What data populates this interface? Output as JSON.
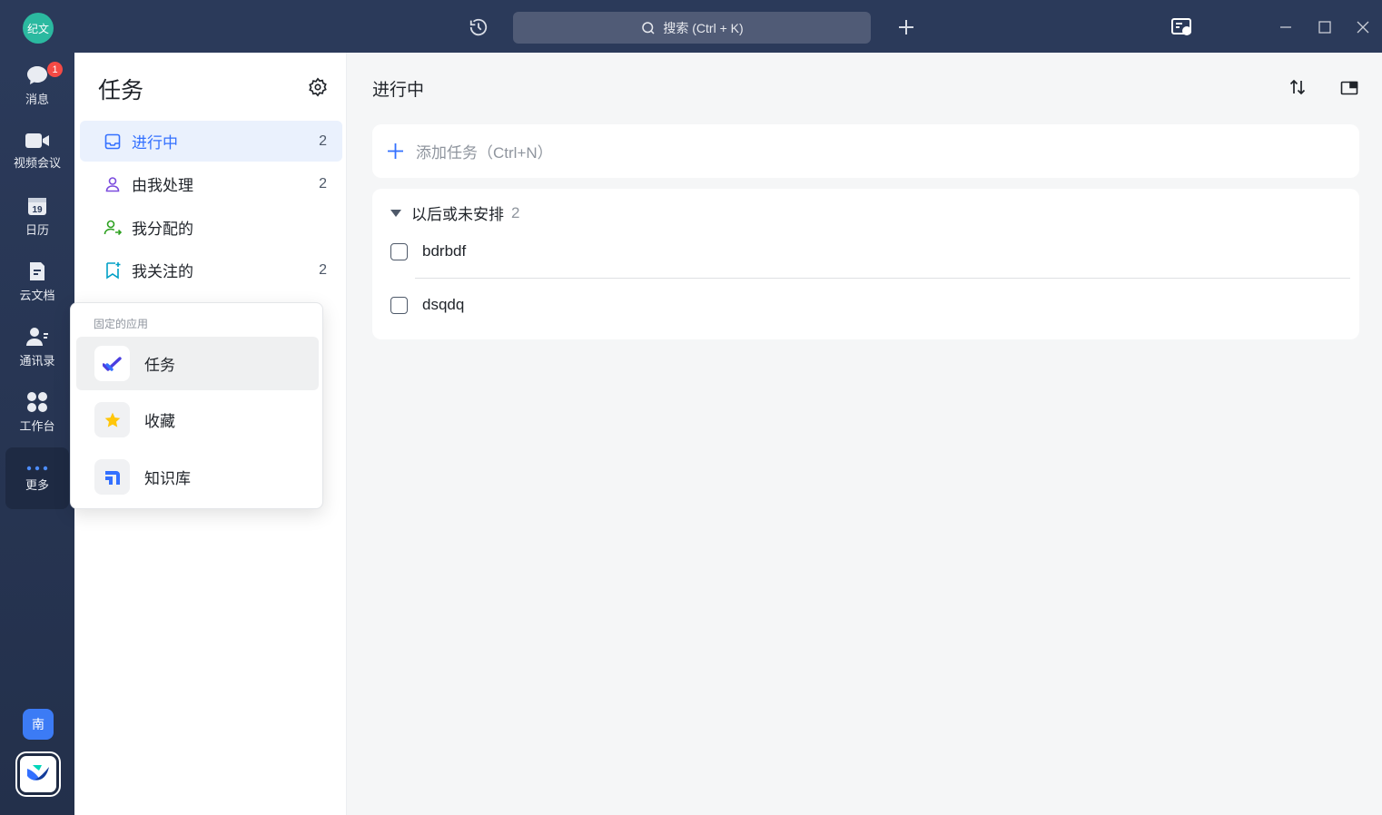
{
  "titlebar": {
    "avatar_text": "纪文",
    "search_placeholder": "搜索 (Ctrl + K)",
    "icons": [
      "history-icon",
      "search-icon",
      "plus-icon",
      "help-desk-icon",
      "minimize-icon",
      "maximize-icon",
      "close-icon"
    ]
  },
  "rail": {
    "items": [
      {
        "label": "消息",
        "icon": "message-icon",
        "badge": "1"
      },
      {
        "label": "视频会议",
        "icon": "video-icon"
      },
      {
        "label": "日历",
        "icon": "calendar-icon",
        "icon_text": "19"
      },
      {
        "label": "云文档",
        "icon": "doc-icon"
      },
      {
        "label": "通讯录",
        "icon": "contacts-icon"
      },
      {
        "label": "工作台",
        "icon": "workplace-icon"
      },
      {
        "label": "更多",
        "icon": "more-icon"
      }
    ],
    "org_label": "南"
  },
  "tasknav": {
    "title": "任务",
    "items": [
      {
        "label": "进行中",
        "count": "2",
        "icon": "inbox-icon"
      },
      {
        "label": "由我处理",
        "count": "2",
        "icon": "person-icon"
      },
      {
        "label": "我分配的",
        "count": "",
        "icon": "assign-icon"
      },
      {
        "label": "我关注的",
        "count": "2",
        "icon": "bookmark-icon"
      }
    ]
  },
  "popup": {
    "header": "固定的应用",
    "items": [
      {
        "label": "任务",
        "icon": "task-check-icon"
      },
      {
        "label": "收藏",
        "icon": "star-icon"
      },
      {
        "label": "知识库",
        "icon": "wiki-icon"
      }
    ]
  },
  "main": {
    "title": "进行中",
    "add_task": "添加任务（Ctrl+N）",
    "group": {
      "label": "以后或未安排",
      "count": "2",
      "tasks": [
        "bdrbdf",
        "dsqdq"
      ]
    }
  },
  "colors": {
    "accent": "#3370ff",
    "rail_bg": "#2b3a5a",
    "badge": "#f54a45",
    "avatar": "#2bb9a0"
  }
}
